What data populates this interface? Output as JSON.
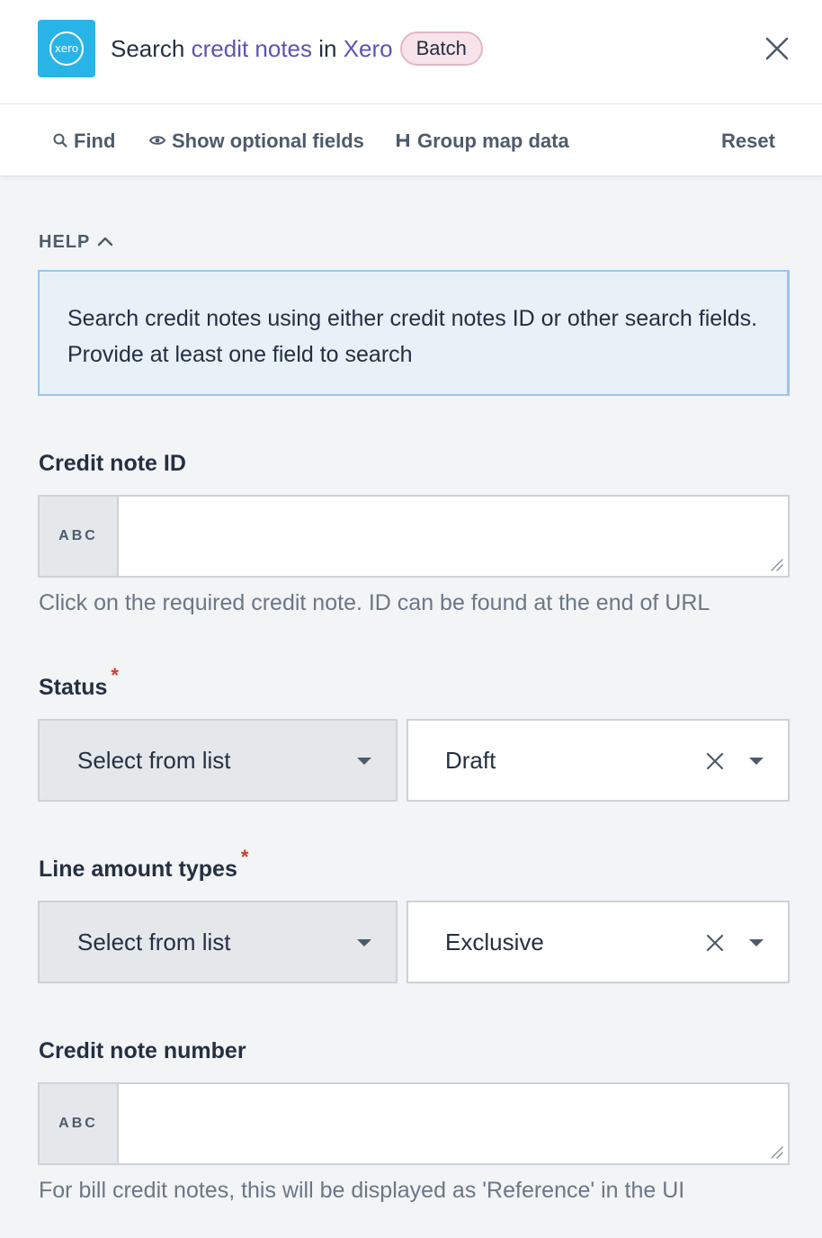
{
  "header": {
    "logo_text": "xero",
    "title_prefix": "Search ",
    "title_object": "credit notes",
    "title_middle": " in ",
    "title_app": "Xero",
    "badge": "Batch"
  },
  "toolbar": {
    "find": "Find",
    "show_optional": "Show optional fields",
    "group_map": "Group map data",
    "reset": "Reset"
  },
  "help": {
    "toggle_label": "HELP",
    "text": "Search credit notes using either credit notes ID or other search fields. Provide at least one field to search"
  },
  "fields": {
    "credit_note_id": {
      "label": "Credit note ID",
      "type_badge": "ABC",
      "value": "",
      "hint": "Click on the required credit note. ID can be found at the end of URL"
    },
    "status": {
      "label": "Status",
      "required": "*",
      "mode": "Select from list",
      "value": "Draft"
    },
    "line_amount_types": {
      "label": "Line amount types",
      "required": "*",
      "mode": "Select from list",
      "value": "Exclusive"
    },
    "credit_note_number": {
      "label": "Credit note number",
      "type_badge": "ABC",
      "value": "",
      "hint": "For bill credit notes, this will be displayed as 'Reference' in the UI"
    }
  },
  "colors": {
    "accent": "#5b54b5",
    "xero_blue": "#29b4e8",
    "required": "#d33a2c",
    "help_bg": "#e8f0f8",
    "badge_bg": "#f8e3ea"
  },
  "icons": {
    "logo": "xero-logo-icon",
    "close": "close-icon",
    "find": "search-icon",
    "optional": "eye-icon",
    "group_map": "group-map-icon",
    "help_toggle": "chevron-up-icon",
    "dropdown": "caret-down-icon",
    "clear": "clear-icon",
    "resize": "resize-grip-icon"
  }
}
